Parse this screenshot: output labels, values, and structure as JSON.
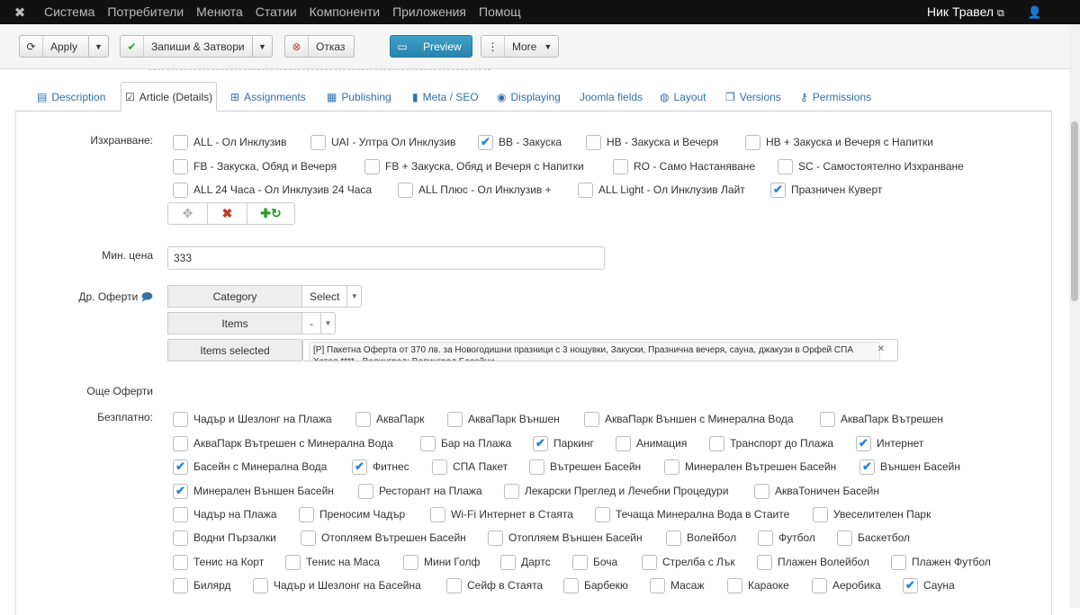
{
  "topnav": {
    "logo_icon": "joomla-icon",
    "menu": [
      "Система",
      "Потребители",
      "Менюта",
      "Статии",
      "Компоненти",
      "Приложения",
      "Помощ"
    ],
    "user": "Ник Травел",
    "external_icon": "⧉",
    "person_icon": "user-icon"
  },
  "toolbar": {
    "apply": "Apply",
    "save_close": "Запиши & Затвори",
    "cancel": "Отказ",
    "preview": "Preview",
    "more": "More"
  },
  "tabs": [
    "Description",
    "Article (Details)",
    "Assignments",
    "Publishing",
    "Meta / SEO",
    "Displaying",
    "Joomla fields",
    "Layout",
    "Versions",
    "Permissions"
  ],
  "form": {
    "board_label": "Изхранване:",
    "board_options": [
      {
        "label": "ALL - Ол Инклузив",
        "checked": false
      },
      {
        "label": "UAI - Ултра Ол Инклузив",
        "checked": false
      },
      {
        "label": "BB - Закуска",
        "checked": true
      },
      {
        "label": "HB - Закуска и Вечеря",
        "checked": false
      },
      {
        "label": "HB + Закуска и Вечеря с Напитки",
        "checked": false
      },
      {
        "label": "FB - Закуска, Обяд и Вечеря",
        "checked": false
      },
      {
        "label": "FB + Закуска, Обяд и Вечеря с Напитки",
        "checked": false
      },
      {
        "label": "RO - Само Настаняване",
        "checked": false
      },
      {
        "label": "SC - Самостоятелно Изхранване",
        "checked": false
      },
      {
        "label": "ALL 24 Часа - Ол Инклузив 24 Часа",
        "checked": false
      },
      {
        "label": "ALL Плюс - Ол Инклузив +",
        "checked": false
      },
      {
        "label": "ALL Light - Ол Инклузив Лайт",
        "checked": false
      },
      {
        "label": "Празничен Куверт",
        "checked": true
      }
    ],
    "min_price_label": "Мин. цена",
    "min_price_value": "333",
    "other_offers_label": "Др. Оферти",
    "category_label": "Category",
    "category_value": "Select",
    "items_label": "Items",
    "items_value": "-",
    "items_selected_label": "Items selected",
    "items_selected_value": "[P] Пакетна Оферта от 370 лв. за Новогодишни празници с 3 нощувки, Закуски, Празнична вечеря, сауна, джакузи в Орфей СПА Хотел **** - Велинград; Велинград Басейни",
    "more_offers_label": "Още Оферти",
    "free_label": "Безплатно:",
    "free_options": [
      {
        "label": "Чадър и Шезлонг на Плажа",
        "checked": false
      },
      {
        "label": "АкваПарк",
        "checked": false
      },
      {
        "label": "АкваПарк Външен",
        "checked": false
      },
      {
        "label": "АкваПарк Външен с Минерална Вода",
        "checked": false
      },
      {
        "label": "АкваПарк Вътрешен",
        "checked": false
      },
      {
        "label": "АкваПарк Вътрешен с Минерална Вода",
        "checked": false
      },
      {
        "label": "Бар на Плажа",
        "checked": false
      },
      {
        "label": "Паркинг",
        "checked": true
      },
      {
        "label": "Анимация",
        "checked": false
      },
      {
        "label": "Транспорт до Плажа",
        "checked": false
      },
      {
        "label": "Интернет",
        "checked": true
      },
      {
        "label": "Басейн с Минерална Вода",
        "checked": true
      },
      {
        "label": "Фитнес",
        "checked": true
      },
      {
        "label": "СПА Пакет",
        "checked": false
      },
      {
        "label": "Вътрешен Басейн",
        "checked": false
      },
      {
        "label": "Минерален Вътрешен Басейн",
        "checked": false
      },
      {
        "label": "Външен Басейн",
        "checked": true
      },
      {
        "label": "Минерален Външен Басейн",
        "checked": true
      },
      {
        "label": "Ресторант на Плажа",
        "checked": false
      },
      {
        "label": "Лекарски Преглед и Лечебни Процедури",
        "checked": false
      },
      {
        "label": "АкваТоничен Басейн",
        "checked": false
      },
      {
        "label": "Чадър на Плажа",
        "checked": false
      },
      {
        "label": "Преносим Чадър",
        "checked": false
      },
      {
        "label": "Wi-Fi Интернет в Стаята",
        "checked": false
      },
      {
        "label": "Течаща Минерална Вода в Стаите",
        "checked": false
      },
      {
        "label": "Увеселителен Парк",
        "checked": false
      },
      {
        "label": "Водни Пързалки",
        "checked": false
      },
      {
        "label": "Отопляем Вътрешен Басейн",
        "checked": false
      },
      {
        "label": "Отопляем Външен Басейн",
        "checked": false
      },
      {
        "label": "Волейбол",
        "checked": false
      },
      {
        "label": "Футбол",
        "checked": false
      },
      {
        "label": "Баскетбол",
        "checked": false
      },
      {
        "label": "Тенис на Корт",
        "checked": false
      },
      {
        "label": "Тенис на Маса",
        "checked": false
      },
      {
        "label": "Мини Голф",
        "checked": false
      },
      {
        "label": "Дартс",
        "checked": false
      },
      {
        "label": "Боча",
        "checked": false
      },
      {
        "label": "Стрелба с Лък",
        "checked": false
      },
      {
        "label": "Плажен Волейбол",
        "checked": false
      },
      {
        "label": "Плажен Футбол",
        "checked": false
      },
      {
        "label": "Билярд",
        "checked": false
      },
      {
        "label": "Чадър и Шезлонг на Басейна",
        "checked": false
      },
      {
        "label": "Сейф в Стаята",
        "checked": false
      },
      {
        "label": "Барбекю",
        "checked": false
      },
      {
        "label": "Масаж",
        "checked": false
      },
      {
        "label": "Караоке",
        "checked": false
      },
      {
        "label": "Аеробика",
        "checked": false
      },
      {
        "label": "Сауна",
        "checked": true
      }
    ]
  }
}
